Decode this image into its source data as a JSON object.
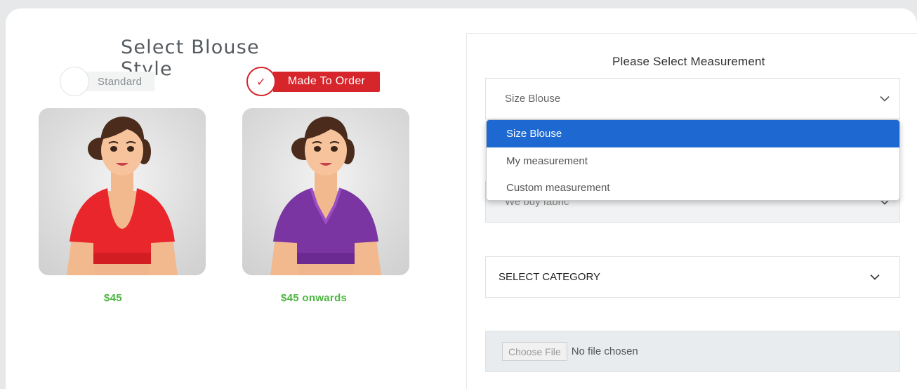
{
  "left": {
    "title": "Select Blouse Style",
    "options": [
      {
        "label": "Standard",
        "price": "$45",
        "selected": false
      },
      {
        "label": "Made To Order",
        "price": "$45 onwards",
        "selected": true
      }
    ],
    "check_glyph": "✓"
  },
  "right": {
    "title": "Please Select Measurement",
    "size_select": {
      "value": "Size Blouse"
    },
    "dropdown": {
      "options": [
        "Size Blouse",
        "My measurement",
        "Custom measurement"
      ],
      "selected": "Size Blouse"
    },
    "fabric_select": {
      "value": "We buy fabric"
    },
    "category_select": {
      "value": "SELECT CATEGORY"
    },
    "file": {
      "button": "Choose File",
      "status": "No file chosen"
    }
  },
  "colors": {
    "accent_red": "#d6262c",
    "price_green": "#4cb63f",
    "dropdown_highlight": "#1d68d1",
    "blouse_standard": "#e8262b",
    "blouse_made_to_order": "#7a35a3"
  },
  "icons": [
    "check-icon",
    "chevron-down-icon"
  ]
}
